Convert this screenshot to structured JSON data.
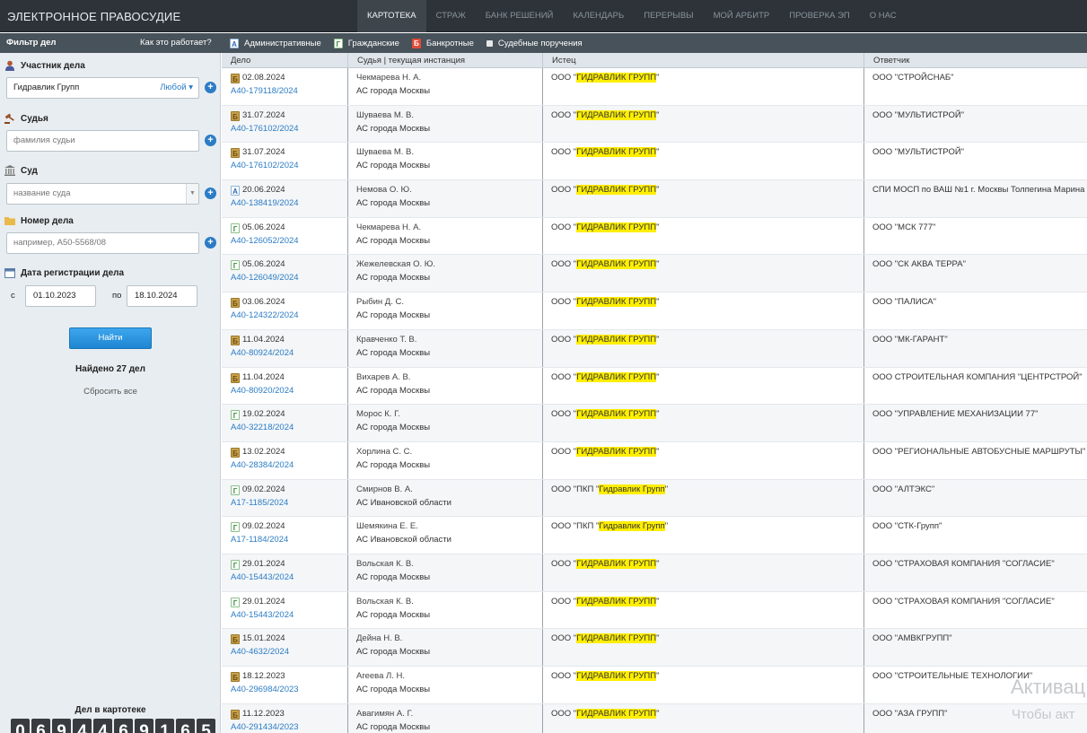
{
  "header": {
    "brand": "ЭЛЕКТРОННОЕ ПРАВОСУДИЕ",
    "nav": [
      {
        "label": "КАРТОТЕКА",
        "active": true
      },
      {
        "label": "СТРАЖ",
        "active": false
      },
      {
        "label": "БАНК РЕШЕНИЙ",
        "active": false
      },
      {
        "label": "КАЛЕНДАРЬ",
        "active": false
      },
      {
        "label": "ПЕРЕРЫВЫ",
        "active": false
      },
      {
        "label": "МОЙ АРБИТР",
        "active": false
      },
      {
        "label": "ПРОВЕРКА ЭП",
        "active": false
      },
      {
        "label": "О НАС",
        "active": false
      }
    ]
  },
  "subbar": {
    "filter_title": "Фильтр дел",
    "how_link": "Как это работает?",
    "case_types": [
      {
        "icon": "administrative-icon",
        "glyph": "A",
        "label": "Административные"
      },
      {
        "icon": "civil-icon",
        "glyph": "Г",
        "label": "Гражданские"
      },
      {
        "icon": "bankruptcy-icon",
        "glyph": "Б",
        "label": "Банкротные"
      },
      {
        "icon": "court-orders-icon",
        "glyph": "",
        "label": "Судебные поручения"
      }
    ]
  },
  "sidebar": {
    "participant": {
      "label": "Участник дела",
      "value": "Гидравлик Групп",
      "role": "Любой ▾"
    },
    "judge": {
      "label": "Судья",
      "placeholder": "фамилия судьи"
    },
    "court": {
      "label": "Суд",
      "placeholder": "название суда",
      "arrow": "▼"
    },
    "case_number": {
      "label": "Номер дела",
      "placeholder": "например, А50-5568/08"
    },
    "reg_date": {
      "label": "Дата регистрации дела",
      "from_label": "с",
      "from": "01.10.2023",
      "to_label": "по",
      "to": "18.10.2024"
    },
    "find_button": "Найти",
    "found_text": "Найдено 27 дел",
    "reset_text": "Сбросить все",
    "counter_title": "Дел в картотеке",
    "counter_digits": [
      "0",
      "6",
      "9",
      "4",
      "4",
      "6",
      "9",
      "1",
      "6",
      "5"
    ],
    "plus": "+"
  },
  "table": {
    "headers": [
      "Дело",
      "Судья | текущая инстанция",
      "Истец",
      "Ответчик"
    ],
    "rows": [
      {
        "type": "b",
        "glyph": "Б",
        "date": "02.08.2024",
        "number": "А40-179118/2024",
        "judge": "Чекмарева Н. А.",
        "court": "АС города Москвы",
        "plaintiff_pre": "ООО \"",
        "plaintiff_hl": "ГИДРАВЛИК ГРУПП",
        "plaintiff_post": "\"",
        "defendant": "ООО \"СТРОЙСНАБ\""
      },
      {
        "type": "b",
        "glyph": "Б",
        "date": "31.07.2024",
        "number": "А40-176102/2024",
        "judge": "Шуваева М. В.",
        "court": "АС города Москвы",
        "plaintiff_pre": "ООО \"",
        "plaintiff_hl": "ГИДРАВЛИК ГРУПП",
        "plaintiff_post": "\"",
        "defendant": "ООО \"МУЛЬТИСТРОЙ\""
      },
      {
        "type": "b",
        "glyph": "Б",
        "date": "31.07.2024",
        "number": "А40-176102/2024",
        "judge": "Шуваева М. В.",
        "court": "АС города Москвы",
        "plaintiff_pre": "ООО \"",
        "plaintiff_hl": "ГИДРАВЛИК ГРУПП",
        "plaintiff_post": "\"",
        "defendant": "ООО \"МУЛЬТИСТРОЙ\""
      },
      {
        "type": "a",
        "glyph": "A",
        "date": "20.06.2024",
        "number": "А40-138419/2024",
        "judge": "Немова О. Ю.",
        "court": "АС города Москвы",
        "plaintiff_pre": "ООО \"",
        "plaintiff_hl": "ГИДРАВЛИК ГРУПП",
        "plaintiff_post": "\"",
        "defendant": "СПИ МОСП по ВАШ №1 г. Москвы Толпегина Марина"
      },
      {
        "type": "g",
        "glyph": "Г",
        "date": "05.06.2024",
        "number": "А40-126052/2024",
        "judge": "Чекмарева Н. А.",
        "court": "АС города Москвы",
        "plaintiff_pre": "ООО \"",
        "plaintiff_hl": "ГИДРАВЛИК ГРУПП",
        "plaintiff_post": "\"",
        "defendant": "ООО \"МСК 777\""
      },
      {
        "type": "g",
        "glyph": "Г",
        "date": "05.06.2024",
        "number": "А40-126049/2024",
        "judge": "Жежелевская О. Ю.",
        "court": "АС города Москвы",
        "plaintiff_pre": "ООО \"",
        "plaintiff_hl": "ГИДРАВЛИК ГРУПП",
        "plaintiff_post": "\"",
        "defendant": "ООО \"СК АКВА ТЕРРА\""
      },
      {
        "type": "b",
        "glyph": "Б",
        "date": "03.06.2024",
        "number": "А40-124322/2024",
        "judge": "Рыбин Д. С.",
        "court": "АС города Москвы",
        "plaintiff_pre": "ООО \"",
        "plaintiff_hl": "ГИДРАВЛИК ГРУПП",
        "plaintiff_post": "\"",
        "defendant": "ООО \"ПАЛИСА\""
      },
      {
        "type": "b",
        "glyph": "Б",
        "date": "11.04.2024",
        "number": "А40-80924/2024",
        "judge": "Кравченко Т. В.",
        "court": "АС города Москвы",
        "plaintiff_pre": "ООО \"",
        "plaintiff_hl": "ГИДРАВЛИК ГРУПП",
        "plaintiff_post": "\"",
        "defendant": "ООО \"МК-ГАРАНТ\""
      },
      {
        "type": "b",
        "glyph": "Б",
        "date": "11.04.2024",
        "number": "А40-80920/2024",
        "judge": "Вихарев А. В.",
        "court": "АС города Москвы",
        "plaintiff_pre": "ООО \"",
        "plaintiff_hl": "ГИДРАВЛИК ГРУПП",
        "plaintiff_post": "\"",
        "defendant": "ООО СТРОИТЕЛЬНАЯ КОМПАНИЯ \"ЦЕНТРСТРОЙ\""
      },
      {
        "type": "g",
        "glyph": "Г",
        "date": "19.02.2024",
        "number": "А40-32218/2024",
        "judge": "Морос К. Г.",
        "court": "АС города Москвы",
        "plaintiff_pre": "ООО \"",
        "plaintiff_hl": "ГИДРАВЛИК ГРУПП",
        "plaintiff_post": "\"",
        "defendant": "ООО \"УПРАВЛЕНИЕ МЕХАНИЗАЦИИ 77\""
      },
      {
        "type": "b",
        "glyph": "Б",
        "date": "13.02.2024",
        "number": "А40-28384/2024",
        "judge": "Хорлина С. С.",
        "court": "АС города Москвы",
        "plaintiff_pre": "ООО \"",
        "plaintiff_hl": "ГИДРАВЛИК ГРУПП",
        "plaintiff_post": "\"",
        "defendant": "ООО \"РЕГИОНАЛЬНЫЕ АВТОБУСНЫЕ МАРШРУТЫ\""
      },
      {
        "type": "g",
        "glyph": "Г",
        "date": "09.02.2024",
        "number": "А17-1185/2024",
        "judge": "Смирнов В. А.",
        "court": "АС Ивановской области",
        "plaintiff_pre": "ООО \"ПКП \"",
        "plaintiff_hl": "Гидравлик Групп",
        "plaintiff_post": "\"",
        "defendant": "ООО \"АЛТЭКС\""
      },
      {
        "type": "g",
        "glyph": "Г",
        "date": "09.02.2024",
        "number": "А17-1184/2024",
        "judge": "Шемякина Е. Е.",
        "court": "АС Ивановской области",
        "plaintiff_pre": "ООО \"ПКП \"",
        "plaintiff_hl": "Гидравлик Групп",
        "plaintiff_post": "\"",
        "defendant": "ООО \"СТК-Групп\""
      },
      {
        "type": "g",
        "glyph": "Г",
        "date": "29.01.2024",
        "number": "А40-15443/2024",
        "judge": "Вольская К. В.",
        "court": "АС города Москвы",
        "plaintiff_pre": "ООО \"",
        "plaintiff_hl": "ГИДРАВЛИК ГРУПП",
        "plaintiff_post": "\"",
        "defendant": "ООО \"СТРАХОВАЯ КОМПАНИЯ \"СОГЛАСИЕ\""
      },
      {
        "type": "g",
        "glyph": "Г",
        "date": "29.01.2024",
        "number": "А40-15443/2024",
        "judge": "Вольская К. В.",
        "court": "АС города Москвы",
        "plaintiff_pre": "ООО \"",
        "plaintiff_hl": "ГИДРАВЛИК ГРУПП",
        "plaintiff_post": "\"",
        "defendant": "ООО \"СТРАХОВАЯ КОМПАНИЯ \"СОГЛАСИЕ\""
      },
      {
        "type": "b",
        "glyph": "Б",
        "date": "15.01.2024",
        "number": "А40-4632/2024",
        "judge": "Дейна Н. В.",
        "court": "АС города Москвы",
        "plaintiff_pre": "ООО \"",
        "plaintiff_hl": "ГИДРАВЛИК ГРУПП",
        "plaintiff_post": "\"",
        "defendant": "ООО \"АМВКГРУПП\""
      },
      {
        "type": "b",
        "glyph": "Б",
        "date": "18.12.2023",
        "number": "А40-296984/2023",
        "judge": "Агеева Л. Н.",
        "court": "АС города Москвы",
        "plaintiff_pre": "ООО \"",
        "plaintiff_hl": "ГИДРАВЛИК ГРУПП",
        "plaintiff_post": "\"",
        "defendant": "ООО \"СТРОИТЕЛЬНЫЕ ТЕХНОЛОГИИ\""
      },
      {
        "type": "b",
        "glyph": "Б",
        "date": "11.12.2023",
        "number": "А40-291434/2023",
        "judge": "Авагимян А. Г.",
        "court": "АС города Москвы",
        "plaintiff_pre": "ООО \"",
        "plaintiff_hl": "ГИДРАВЛИК ГРУПП",
        "plaintiff_post": "\"",
        "defendant": "ООО \"АЗА ГРУПП\""
      }
    ]
  },
  "watermark": {
    "line1": "Активац",
    "line2": "Чтобы акт"
  }
}
